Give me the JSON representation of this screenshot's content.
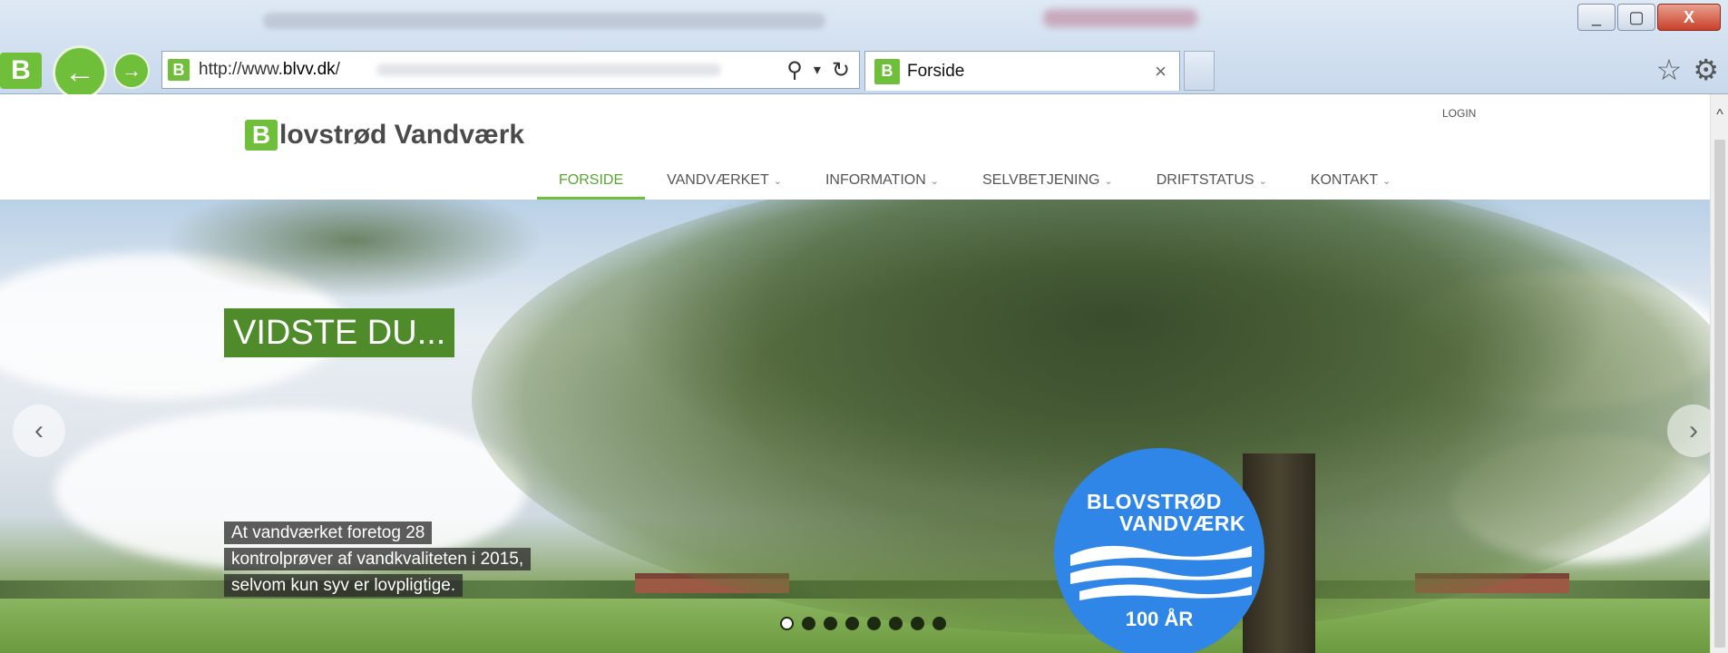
{
  "browser": {
    "url_prefix": "http://www.",
    "url_domain": "blvv.dk",
    "url_suffix": "/",
    "tab_title": "Forside",
    "site_icon_letter": "B",
    "back_glyph": "←",
    "forward_glyph": "→",
    "search_glyph": "⚲",
    "dropdown_glyph": "▾",
    "refresh_glyph": "↻",
    "close_tab_glyph": "×",
    "star_glyph": "☆",
    "gear_glyph": "⚙",
    "minimize_glyph": "_",
    "maximize_glyph": "▢",
    "close_window_glyph": "X"
  },
  "site": {
    "brand_letter": "B",
    "brand_rest": "lovstrød Vandværk",
    "login": "LOGIN",
    "nav": [
      {
        "label": "FORSIDE",
        "active": true
      },
      {
        "label": "VANDVÆRKET",
        "caret": "⌄"
      },
      {
        "label": "INFORMATION",
        "caret": "⌄"
      },
      {
        "label": "SELVBETJENING",
        "caret": "⌄"
      },
      {
        "label": "DRIFTSTATUS",
        "caret": "⌄"
      },
      {
        "label": "KONTAKT",
        "caret": "⌄"
      }
    ]
  },
  "hero": {
    "heading": "VIDSTE DU...",
    "caption_lines": [
      "At vandværket foretog 28",
      "kontrolprøver af vandkvaliteten i 2015,",
      "selvom kun syv er lovpligtige."
    ],
    "prev_glyph": "‹",
    "next_glyph": "›",
    "slide_count": 8,
    "active_slide": 1
  },
  "badge": {
    "line1": "BLOVSTRØD",
    "line2": "VANDVÆRK",
    "year": "100 ÅR"
  },
  "scrollbar": {
    "up_glyph": "^"
  },
  "colors": {
    "brand_green": "#6fbf3a",
    "nav_active": "#5aa531",
    "heading_bg": "#4f8a2b",
    "badge_blue": "#2f86e6"
  }
}
